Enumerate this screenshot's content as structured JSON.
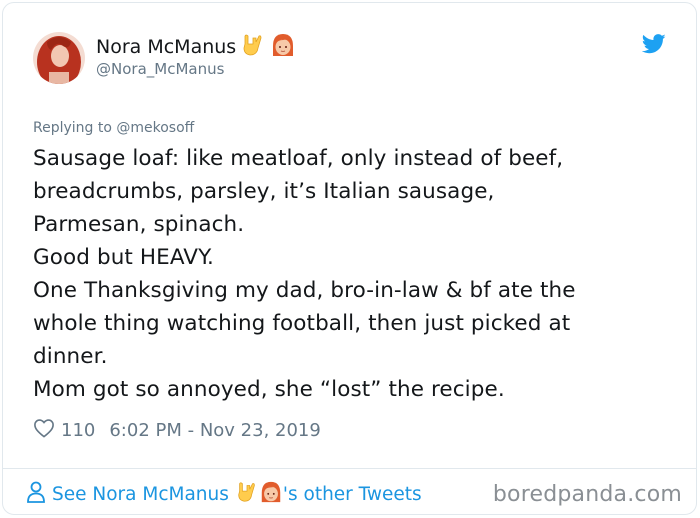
{
  "author": {
    "name": "Nora McManus",
    "handle": "@Nora_McManus",
    "name_emojis": [
      "rock-on-hand-emoji",
      "redhead-woman-emoji"
    ]
  },
  "reply_to": "Replying to @mekosoff",
  "tweet_lines": [
    "Sausage loaf: like meatloaf, only instead of beef,",
    "breadcrumbs, parsley, it’s Italian sausage,",
    "Parmesan, spinach.",
    "Good but HEAVY.",
    "One Thanksgiving my dad, bro-in-law & bf ate the",
    "whole thing watching football, then just picked at",
    "dinner.",
    "Mom got so annoyed, she “lost” the recipe."
  ],
  "meta": {
    "likes": "110",
    "timestamp": "6:02 PM - Nov 23, 2019"
  },
  "footer": {
    "prefix": "See Nora McManus",
    "suffix": "'s other Tweets"
  },
  "watermark": "boredpanda.com",
  "colors": {
    "accent": "#1da1f2",
    "link": "#1b95e0",
    "muted": "#657786"
  }
}
